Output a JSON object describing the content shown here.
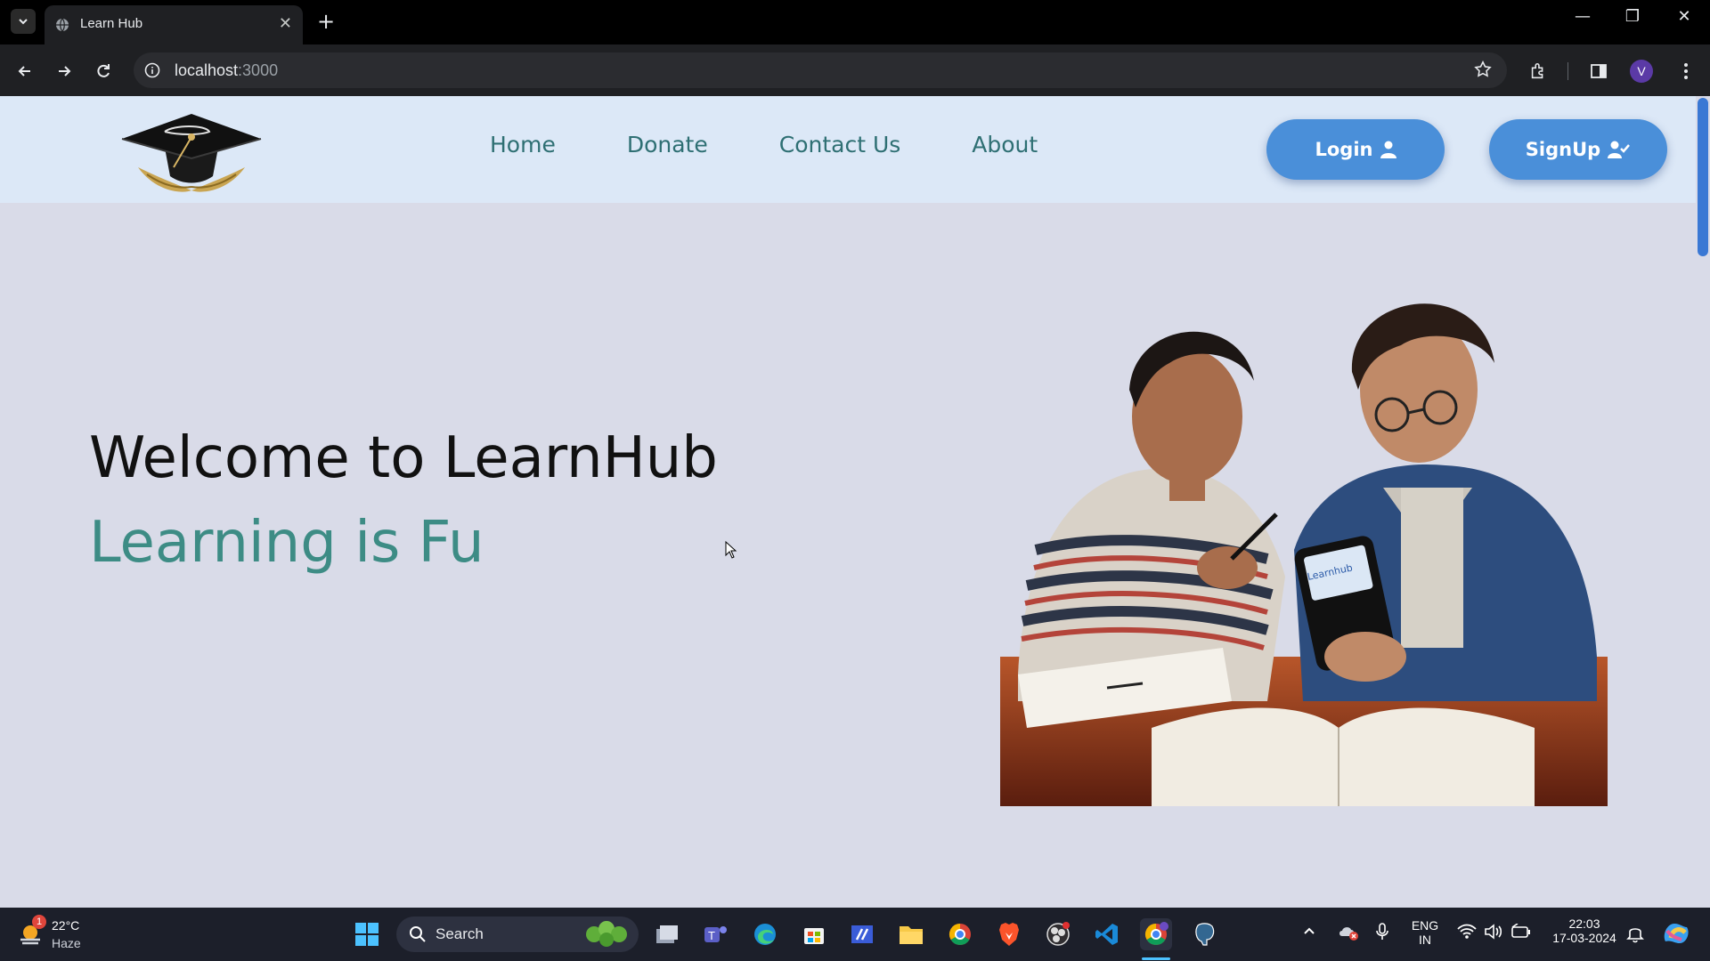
{
  "browser": {
    "tab_title": "Learn Hub",
    "url_host": "localhost",
    "url_port": ":3000",
    "profile_initial": "V"
  },
  "site": {
    "nav": [
      "Home",
      "Donate",
      "Contact Us",
      "About"
    ],
    "login_label": "Login",
    "signup_label": "SignUp",
    "hero_title": "Welcome to LearnHub",
    "hero_subtitle": "Learning is Fu",
    "phone_screen_text": "Learnhub"
  },
  "taskbar": {
    "weather_temp": "22°C",
    "weather_condition": "Haze",
    "weather_badge": "1",
    "search_placeholder": "Search",
    "lang_top": "ENG",
    "lang_bottom": "IN",
    "time": "22:03",
    "date": "17-03-2024"
  },
  "colors": {
    "page_bg": "#d9dbe8",
    "navbar_bg": "#dce8f7",
    "accent_teal": "#2e6f73",
    "button_blue": "#4a8fd9"
  }
}
